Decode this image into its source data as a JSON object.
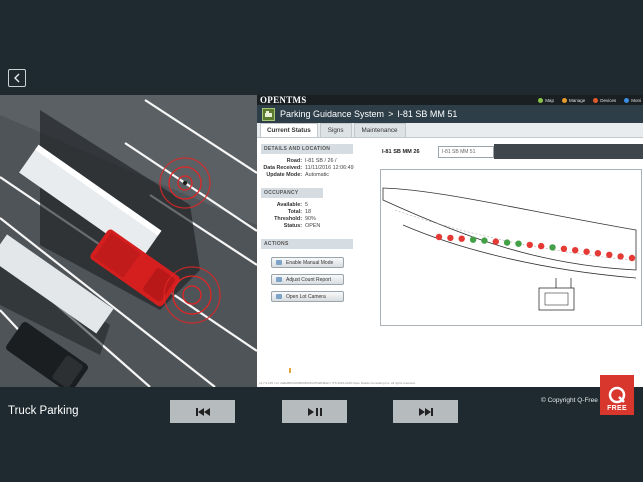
{
  "app": {
    "logo_text": "OPENTMS",
    "system_title": "Parking Guidance System",
    "title_separator": ">",
    "site_title": "I-81 SB MM 51"
  },
  "topnav": [
    {
      "label": "Map",
      "icon": "map-icon",
      "color": "#8bc34a"
    },
    {
      "label": "Manage",
      "icon": "manage-icon",
      "color": "#e89a2b"
    },
    {
      "label": "Devices",
      "icon": "devices-icon",
      "color": "#e05a2a"
    },
    {
      "label": "Moni",
      "icon": "monitor-icon",
      "color": "#3a8de0"
    }
  ],
  "tabs": [
    "Current Status",
    "Signs",
    "Maintenance"
  ],
  "details": {
    "heading": "DETAILS AND LOCATION",
    "rows": [
      {
        "k": "Road:",
        "v": "I-81 SB / 26 /"
      },
      {
        "k": "Data Received:",
        "v": "11/11/2016 12:06:49"
      },
      {
        "k": "Update Mode:",
        "v": "Automatic"
      }
    ]
  },
  "occupancy": {
    "heading": "OCCUPANCY",
    "rows": [
      {
        "k": "Available:",
        "v": "5"
      },
      {
        "k": "Total:",
        "v": "18"
      },
      {
        "k": "Threshold:",
        "v": "90%"
      },
      {
        "k": "Status:",
        "v": "OPEN"
      }
    ]
  },
  "actions": {
    "heading": "ACTIONS",
    "buttons": [
      "Enable Manual Mode",
      "Adjust Count Report",
      "Open Lot Camera"
    ]
  },
  "location": {
    "label": "I-81 SB MM 26",
    "input_value": "I-81 SB MM 51"
  },
  "lot": {
    "spaces": [
      "red",
      "red",
      "red",
      "green",
      "green",
      "red",
      "green",
      "green",
      "red",
      "red",
      "green",
      "red",
      "red",
      "red",
      "red",
      "red",
      "red",
      "red"
    ],
    "total": 18,
    "available": 5
  },
  "footer_text": "v4.7.2.135 | sn: da8a95b1000f9933f2f43d76d2f48a1f | ITS 2016-2019 Open Roads Consulting Inc. All rights reserved.",
  "bottom": {
    "title": "Truck Parking",
    "controls": [
      "prev-icon",
      "play-pause-icon",
      "next-icon"
    ],
    "copyright": "© Copyright Q-Free",
    "brand": "FREE",
    "brand_color": "#d8372e"
  }
}
